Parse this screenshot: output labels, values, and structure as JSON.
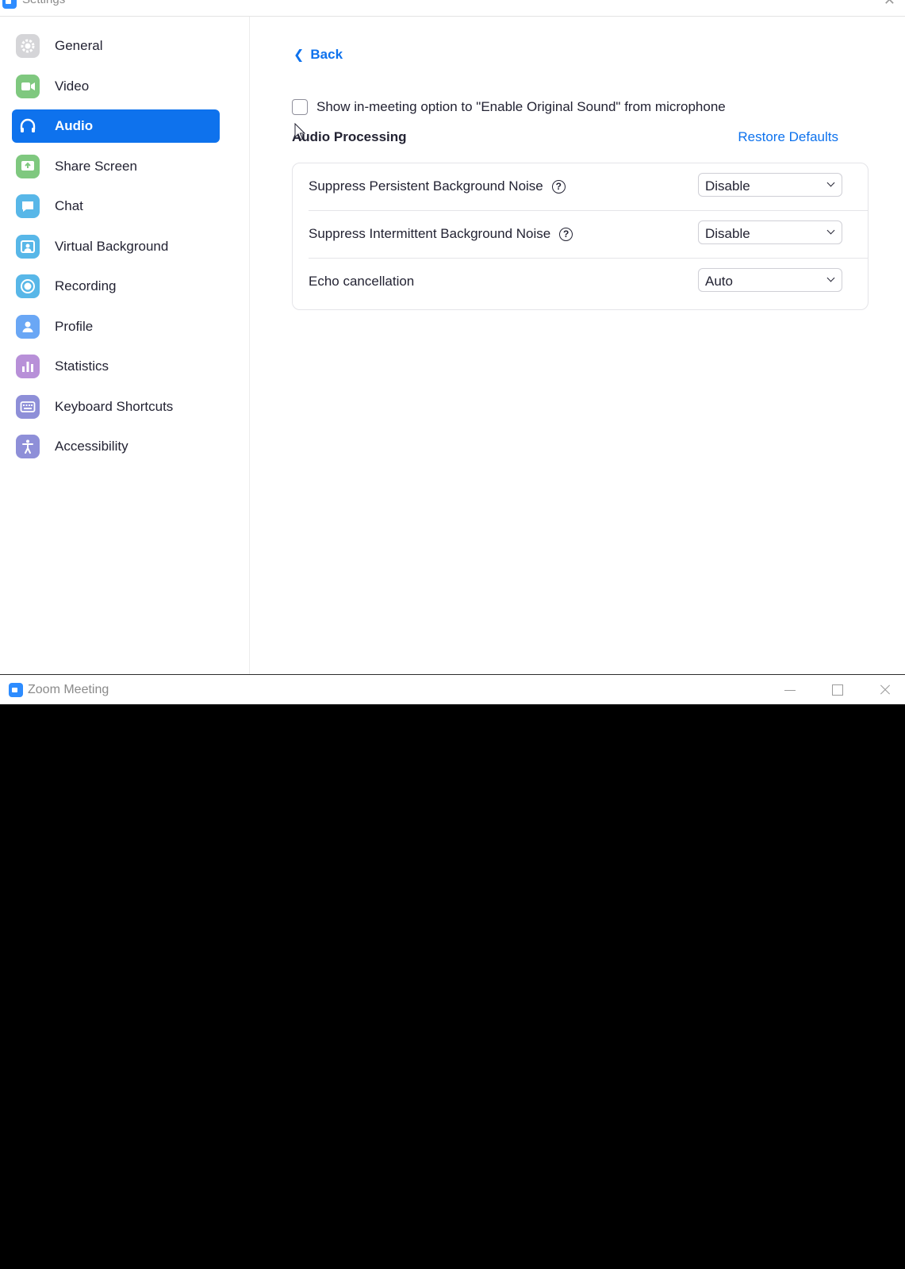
{
  "settings_window": {
    "title": "Settings"
  },
  "sidebar": {
    "items": [
      {
        "label": "General",
        "icon": "gear-icon",
        "color": "#b9b9bd"
      },
      {
        "label": "Video",
        "icon": "video-camera-icon",
        "color": "#7fc87f"
      },
      {
        "label": "Audio",
        "icon": "headphones-icon",
        "color": "#0e72ed",
        "active": true
      },
      {
        "label": "Share Screen",
        "icon": "share-screen-icon",
        "color": "#7fc87f"
      },
      {
        "label": "Chat",
        "icon": "chat-bubble-icon",
        "color": "#58b7e8"
      },
      {
        "label": "Virtual Background",
        "icon": "virtual-background-icon",
        "color": "#58b7e8"
      },
      {
        "label": "Recording",
        "icon": "recording-icon",
        "color": "#58b7e8"
      },
      {
        "label": "Profile",
        "icon": "profile-icon",
        "color": "#6aa7f5"
      },
      {
        "label": "Statistics",
        "icon": "statistics-icon",
        "color": "#b890d8"
      },
      {
        "label": "Keyboard Shortcuts",
        "icon": "keyboard-icon",
        "color": "#8e8fd8"
      },
      {
        "label": "Accessibility",
        "icon": "accessibility-icon",
        "color": "#8e8fd8"
      }
    ]
  },
  "content": {
    "back_label": "Back",
    "original_sound_option": {
      "label": "Show in-meeting option to \"Enable Original Sound\" from microphone",
      "checked": false
    },
    "section_title": "Audio Processing",
    "restore_defaults_label": "Restore Defaults",
    "rows": [
      {
        "label": "Suppress Persistent Background Noise",
        "has_help": true,
        "value": "Disable"
      },
      {
        "label": "Suppress Intermittent Background Noise",
        "has_help": true,
        "value": "Disable"
      },
      {
        "label": "Echo cancellation",
        "has_help": false,
        "value": "Auto"
      }
    ],
    "help_glyph": "?"
  },
  "meeting_window": {
    "title": "Zoom Meeting"
  },
  "colors": {
    "accent": "#0e72ed",
    "text": "#232333",
    "meeting_background": "#000000"
  }
}
